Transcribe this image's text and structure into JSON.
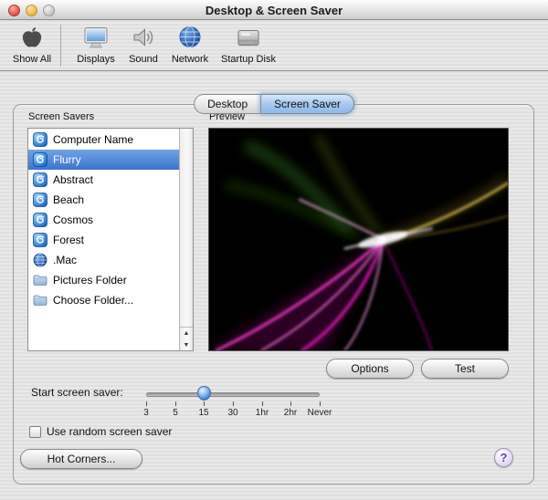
{
  "window": {
    "title": "Desktop & Screen Saver"
  },
  "toolbar": {
    "items": [
      {
        "label": "Show All",
        "icon": "apple-icon"
      },
      {
        "label": "Displays",
        "icon": "display-icon"
      },
      {
        "label": "Sound",
        "icon": "speaker-icon"
      },
      {
        "label": "Network",
        "icon": "globe-icon"
      },
      {
        "label": "Startup Disk",
        "icon": "disk-icon"
      }
    ]
  },
  "tabs": [
    {
      "label": "Desktop",
      "selected": false
    },
    {
      "label": "Screen Saver",
      "selected": true
    }
  ],
  "screensavers": {
    "label": "Screen Savers",
    "items": [
      {
        "label": "Computer Name",
        "icon": "swirl-icon",
        "selected": false
      },
      {
        "label": "Flurry",
        "icon": "swirl-icon",
        "selected": true
      },
      {
        "label": "Abstract",
        "icon": "swirl-icon",
        "selected": false
      },
      {
        "label": "Beach",
        "icon": "swirl-icon",
        "selected": false
      },
      {
        "label": "Cosmos",
        "icon": "swirl-icon",
        "selected": false
      },
      {
        "label": "Forest",
        "icon": "swirl-icon",
        "selected": false
      },
      {
        "label": ".Mac",
        "icon": "globe-icon",
        "selected": false
      },
      {
        "label": "Pictures Folder",
        "icon": "folder-icon",
        "selected": false
      },
      {
        "label": "Choose Folder...",
        "icon": "folder-icon",
        "selected": false
      }
    ]
  },
  "preview": {
    "label": "Preview"
  },
  "buttons": {
    "options": "Options",
    "test": "Test",
    "hot_corners": "Hot Corners...",
    "help": "?"
  },
  "slider": {
    "label": "Start screen saver:",
    "ticks": [
      "3",
      "5",
      "15",
      "30",
      "1hr",
      "2hr",
      "Never"
    ],
    "value": "15"
  },
  "random_checkbox": {
    "label": "Use random screen saver",
    "checked": false
  },
  "scrollbar": {
    "up_arrow": "▲",
    "down_arrow": "▼"
  },
  "colors": {
    "selection_blue": "#3d73cf",
    "tab_selected_blue": "#a6c9ef",
    "help_purple": "#6b3fa0"
  }
}
